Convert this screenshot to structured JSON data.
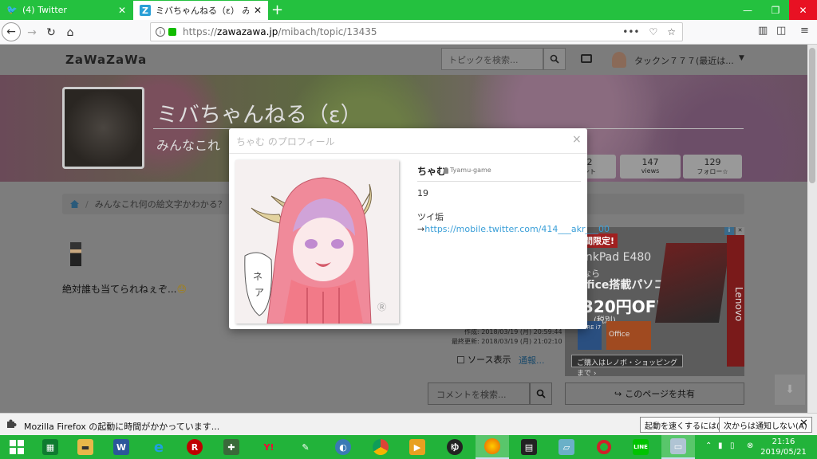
{
  "browser": {
    "tabs": [
      {
        "title": "(4) Twitter",
        "active": false
      },
      {
        "title": "ミバちゃんねる（ε） みんなこれ何の",
        "active": true
      }
    ],
    "url_prefix": "https://",
    "url_domain": "zawazawa.jp",
    "url_path": "/mibach/topic/13435",
    "url_more": "•••"
  },
  "site": {
    "logo": "ZaWaZaWa",
    "search_placeholder": "トピックを検索...",
    "username": "タックン７７７(最近は..."
  },
  "channel": {
    "title": "ミバちゃんねる（ε）",
    "subtitle": "みんなこれ",
    "stats": [
      {
        "value": "2",
        "label": "ント"
      },
      {
        "value": "147",
        "label": "views"
      },
      {
        "value": "129",
        "label": "フォロー☆"
      }
    ]
  },
  "breadcrumb": {
    "topic": "みんなこれ何の絵文字かわかる？"
  },
  "post": {
    "text": "絶対誰も当てられねぇぞ...",
    "created": "作成: 2018/03/19 (月) 20:59:44",
    "updated": "最終更新: 2018/03/19 (月) 21:02:10",
    "source_toggle": "ソース表示",
    "report": "通報..."
  },
  "actions": {
    "comment_search_placeholder": "コメントを検索...",
    "share": "このページを共有"
  },
  "ad": {
    "tagline": "間限定!",
    "model": "inkPad E480",
    "line1": "なら",
    "line2": "ffice搭載パソコンが",
    "price": "320円OFF!",
    "tax": "(税別)",
    "brand": "Lenovo",
    "badge1": "CORE i7",
    "badge2": "Office",
    "cta": "ご購入はレノボ・ショッピングまで ›"
  },
  "modal": {
    "title": "ちゃむ のプロフィール",
    "close": "×",
    "name": "ちゃむ",
    "user_id": "Tyamu-game",
    "bio_line1": "19",
    "bio_prefix": "ツイ垢→",
    "bio_link": "https://mobile.twitter.com/414___akr___00"
  },
  "notification": {
    "text": "Mozilla Firefox の起動に時間がかかっています...",
    "btn1": "起動を速くするには(L)",
    "btn2": "次からは通知しない(A)",
    "close": "✕"
  },
  "taskbar": {
    "time": "21:16",
    "date": "2019/05/21",
    "tray_ime": "A"
  },
  "colors": {
    "taskbar": "#22b33a",
    "tabbar": "#24c13f",
    "link": "#3a9fd8"
  }
}
